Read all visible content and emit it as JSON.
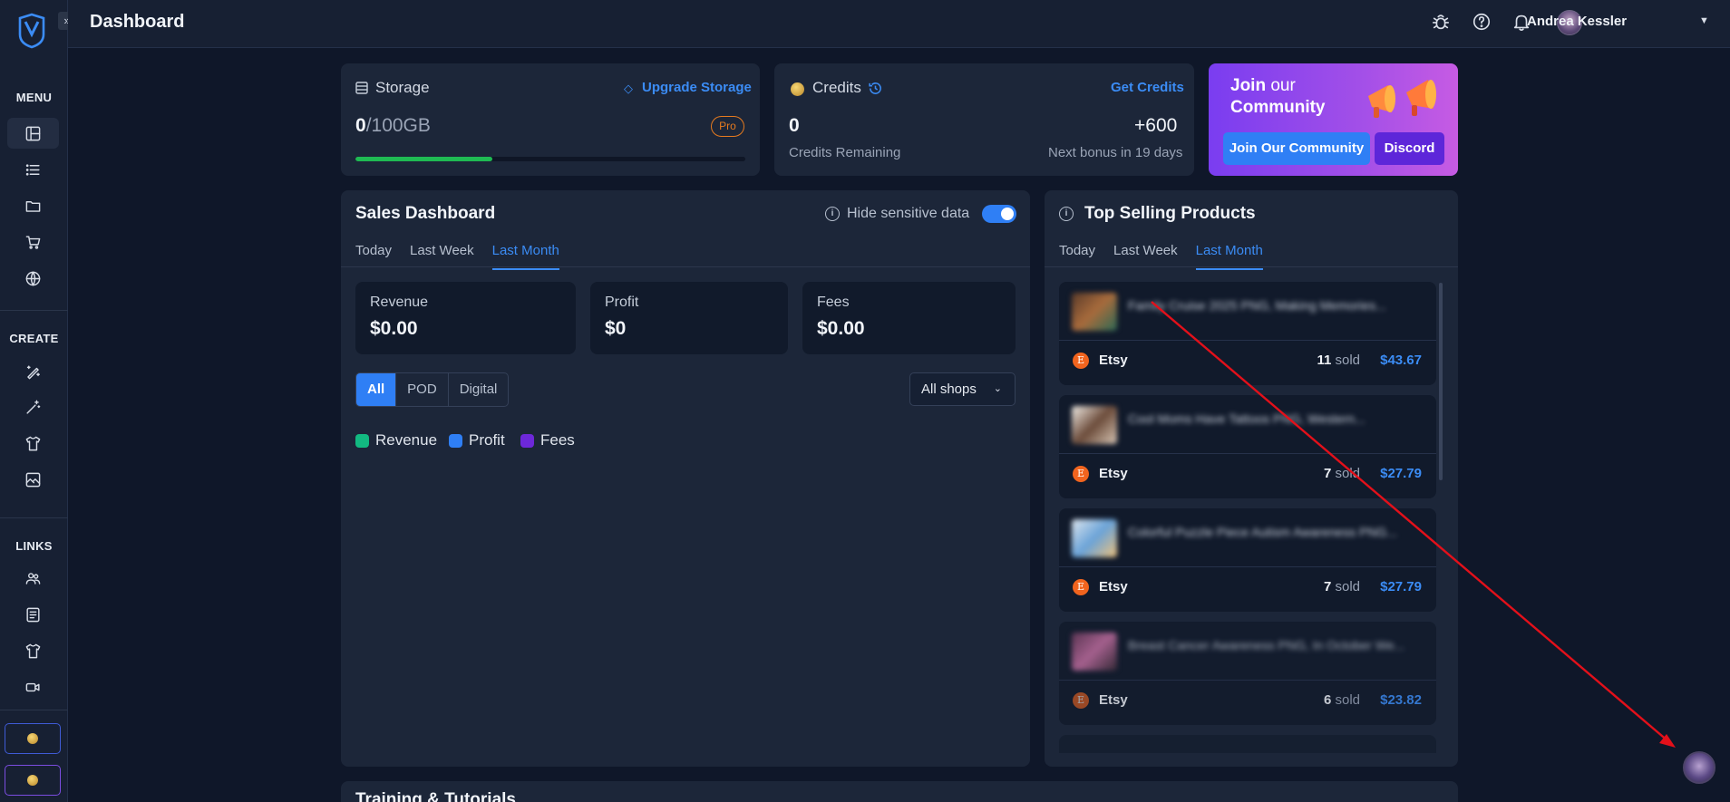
{
  "header": {
    "title": "Dashboard",
    "user_name": "Andrea Kessler"
  },
  "sidebar": {
    "collapse_glyph": "»",
    "sections": {
      "menu": "MENU",
      "create": "CREATE",
      "links": "LINKS"
    },
    "menu_items": [
      "dashboard-icon",
      "list-icon",
      "folder-icon",
      "cart-icon",
      "globe-icon"
    ],
    "create_items": [
      "pen-sparkle-icon",
      "magic-wand-icon",
      "tshirt-icon",
      "gallery-icon"
    ],
    "link_items": [
      "users-icon",
      "article-icon",
      "tshirt-icon",
      "video-icon"
    ]
  },
  "storage": {
    "title": "Storage",
    "upgrade_label": "Upgrade Storage",
    "used": "0",
    "total": "/100GB",
    "badge": "Pro",
    "progress_percent": 35
  },
  "credits": {
    "title": "Credits",
    "get_label": "Get Credits",
    "value": "0",
    "value_caption": "Credits Remaining",
    "bonus": "+600",
    "bonus_caption": "Next bonus in 19 days"
  },
  "community": {
    "title_bold": "Join",
    "title_rest": " our",
    "title_line2": "Community",
    "join_button": "Join Our Community",
    "discord_button": "Discord"
  },
  "sales": {
    "title": "Sales Dashboard",
    "hide_label": "Hide sensitive data",
    "hide_enabled": true,
    "tabs": [
      "Today",
      "Last Week",
      "Last Month"
    ],
    "active_tab": "Last Month",
    "stats": [
      {
        "label": "Revenue",
        "value": "$0.00"
      },
      {
        "label": "Profit",
        "value": "$0"
      },
      {
        "label": "Fees",
        "value": "$0.00"
      }
    ],
    "filters": [
      "All",
      "POD",
      "Digital"
    ],
    "active_filter": "All",
    "shop_select": "All shops",
    "legend": [
      {
        "name": "Revenue",
        "color": "#12b981"
      },
      {
        "name": "Profit",
        "color": "#2f7ff5"
      },
      {
        "name": "Fees",
        "color": "#6d28d9"
      }
    ]
  },
  "top_selling": {
    "title": "Top Selling Products",
    "tabs": [
      "Today",
      "Last Week",
      "Last Month"
    ],
    "active_tab": "Last Month",
    "products": [
      {
        "name": "Family Cruise 2025 PNG, Making Memories...",
        "shop": "Etsy",
        "sold": "11",
        "sold_label": " sold",
        "price": "$43.67"
      },
      {
        "name": "Cool Moms Have Tattoos PNG, Western...",
        "shop": "Etsy",
        "sold": "7",
        "sold_label": " sold",
        "price": "$27.79"
      },
      {
        "name": "Colorful Puzzle Piece Autism Awareness PNG...",
        "shop": "Etsy",
        "sold": "7",
        "sold_label": " sold",
        "price": "$27.79"
      },
      {
        "name": "Breast Cancer Awareness PNG, In October We...",
        "shop": "Etsy",
        "sold": "6",
        "sold_label": " sold",
        "price": "$23.82"
      }
    ]
  },
  "bottom_section_title": "Training & Tutorials",
  "colors": {
    "accent": "#2f7ff5",
    "success": "#1fba53",
    "etsy": "#f1641e",
    "annotation": "#e3101a"
  }
}
